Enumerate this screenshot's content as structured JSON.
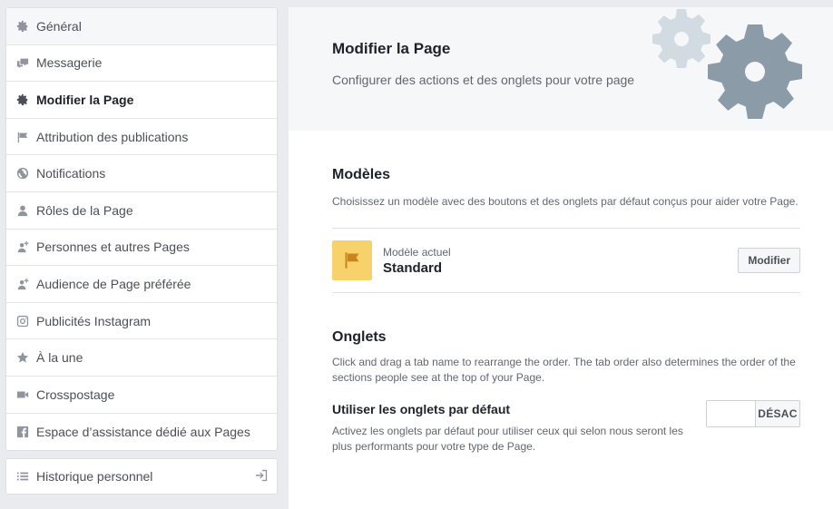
{
  "sidebar": {
    "items": [
      {
        "label": "Général",
        "icon": "gear-icon"
      },
      {
        "label": "Messagerie",
        "icon": "chat-icon"
      },
      {
        "label": "Modifier la Page",
        "icon": "gear-icon"
      },
      {
        "label": "Attribution des publications",
        "icon": "flag-icon"
      },
      {
        "label": "Notifications",
        "icon": "globe-icon"
      },
      {
        "label": "Rôles de la Page",
        "icon": "person-icon"
      },
      {
        "label": "Personnes et autres Pages",
        "icon": "person-add-icon"
      },
      {
        "label": "Audience de Page préférée",
        "icon": "person-add-icon"
      },
      {
        "label": "Publicités Instagram",
        "icon": "instagram-icon"
      },
      {
        "label": "À la une",
        "icon": "star-icon"
      },
      {
        "label": "Crosspostage",
        "icon": "video-camera-icon"
      },
      {
        "label": "Espace d’assistance dédié aux Pages",
        "icon": "facebook-icon"
      }
    ],
    "active_index": 2,
    "history": {
      "label": "Historique personnel",
      "icon": "list-icon",
      "action_icon": "exit-icon"
    }
  },
  "header": {
    "title": "Modifier la Page",
    "subtitle": "Configurer des actions et des onglets pour votre page"
  },
  "models": {
    "title": "Modèles",
    "description": "Choisissez un modèle avec des boutons et des onglets par défaut conçus pour aider votre Page.",
    "current_label": "Modèle actuel",
    "current_name": "Standard",
    "modify_button": "Modifier"
  },
  "tabs": {
    "title": "Onglets",
    "description": "Click and drag a tab name to rearrange the order. The tab order also determines the order of the sections people see at the top of your Page.",
    "default_tabs": {
      "title": "Utiliser les onglets par défaut",
      "description": "Activez les onglets par défaut pour utiliser ceux qui selon nous seront les plus performants pour votre type de Page.",
      "toggle_state": "DÉSAC"
    }
  },
  "colors": {
    "background": "#e9ebee",
    "flag_box": "#f7d26a",
    "gear_light": "#d3dbe2",
    "gear_dark": "#8b9ba7"
  }
}
